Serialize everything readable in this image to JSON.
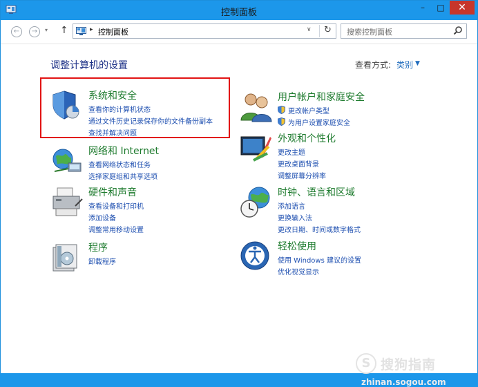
{
  "window": {
    "title": "控制面板",
    "min_label": "–",
    "max_label": "□",
    "close_label": "✕"
  },
  "nav": {
    "back_glyph": "←",
    "forward_glyph": "→",
    "history_glyph": "▾",
    "up_glyph": "↑",
    "address_sep": "▸",
    "address_text": "控制面板",
    "address_dropdown": "∨",
    "refresh_glyph": "↻",
    "search_placeholder": "搜索控制面板"
  },
  "main": {
    "page_title": "调整计算机的设置",
    "view_by_label": "查看方式:",
    "view_by_value": "类别",
    "view_by_arrow": "▼"
  },
  "categories_left": [
    {
      "icon": "security-shield-icon",
      "title": "系统和安全",
      "links": [
        "查看你的计算机状态",
        "通过文件历史记录保存你的文件备份副本",
        "查找并解决问题"
      ]
    },
    {
      "icon": "network-globe-icon",
      "title": "网络和 Internet",
      "links": [
        "查看网络状态和任务",
        "选择家庭组和共享选项"
      ]
    },
    {
      "icon": "printer-icon",
      "title": "硬件和声音",
      "links": [
        "查看设备和打印机",
        "添加设备",
        "调整常用移动设置"
      ]
    },
    {
      "icon": "programs-icon",
      "title": "程序",
      "links": [
        "卸载程序"
      ]
    }
  ],
  "categories_right": [
    {
      "icon": "users-icon",
      "title": "用户帐户和家庭安全",
      "links": [
        "更改帐户类型",
        "为用户设置家庭安全"
      ]
    },
    {
      "icon": "appearance-icon",
      "title": "外观和个性化",
      "links": [
        "更改主题",
        "更改桌面背景",
        "调整屏幕分辨率"
      ]
    },
    {
      "icon": "clock-globe-icon",
      "title": "时钟、语言和区域",
      "links": [
        "添加语言",
        "更换输入法",
        "更改日期、时间或数字格式"
      ]
    },
    {
      "icon": "ease-of-access-icon",
      "title": "轻松使用",
      "links": [
        "使用 Windows 建议的设置",
        "优化视觉显示"
      ]
    }
  ],
  "watermark": {
    "logo_glyph": "S",
    "text": "搜狗指南",
    "url": "zhinan.sogou.com"
  },
  "colors": {
    "titlebar": "#1c97ea",
    "close": "#c7362a",
    "category_title": "#1e7b2e",
    "link": "#1e4fb0",
    "highlight": "#e21313"
  }
}
